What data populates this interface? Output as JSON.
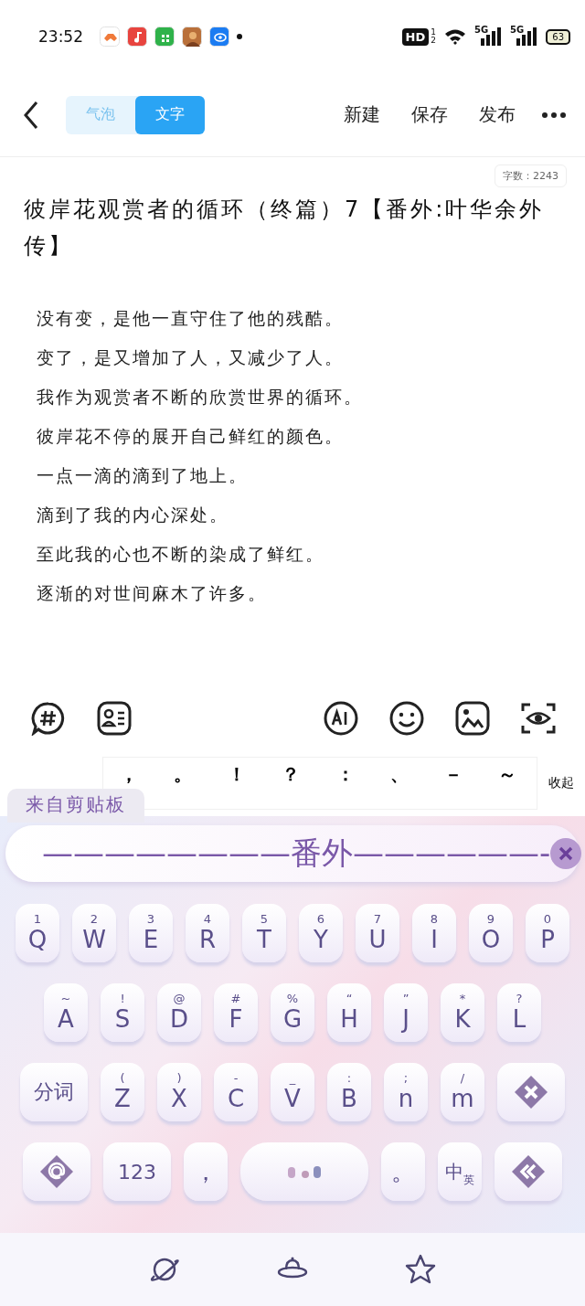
{
  "status_bar": {
    "time": "23:52",
    "hd": "HD",
    "sims": [
      "1",
      "2"
    ],
    "signals": [
      "5G",
      "5G"
    ],
    "battery": "63"
  },
  "header": {
    "tabs": [
      {
        "label": "气泡",
        "selected": false
      },
      {
        "label": "文字",
        "selected": true
      }
    ],
    "actions": [
      "新建",
      "保存",
      "发布"
    ]
  },
  "editor": {
    "word_count": "字数：2243",
    "title": "彼岸花观赏者的循环（终篇）7【番外:叶华余外传】",
    "lines": [
      "没有变，是他一直守住了他的残酷。",
      "变了，是又增加了人，又减少了人。",
      "我作为观赏者不断的欣赏世界的循环。",
      "彼岸花不停的展开自己鲜红的颜色。",
      "一点一滴的滴到了地上。",
      "滴到了我的内心深处。",
      "至此我的心也不断的染成了鲜红。",
      "逐渐的对世间麻木了许多。"
    ]
  },
  "punctuation": {
    "marks": [
      "，",
      "。",
      "！",
      "？",
      "：",
      "、",
      "－",
      "～"
    ],
    "collapse": "收起"
  },
  "clipboard": {
    "tab": "来自剪贴板",
    "text": "————————番外——————-"
  },
  "keyboard": {
    "rows": [
      {
        "keys": [
          {
            "kind": "letter",
            "main": "Q",
            "sub": "1"
          },
          {
            "kind": "letter",
            "main": "W",
            "sub": "2"
          },
          {
            "kind": "letter",
            "main": "E",
            "sub": "3"
          },
          {
            "kind": "letter",
            "main": "R",
            "sub": "4"
          },
          {
            "kind": "letter",
            "main": "T",
            "sub": "5"
          },
          {
            "kind": "letter",
            "main": "Y",
            "sub": "6"
          },
          {
            "kind": "letter",
            "main": "U",
            "sub": "7"
          },
          {
            "kind": "letter",
            "main": "I",
            "sub": "8"
          },
          {
            "kind": "letter",
            "main": "O",
            "sub": "9"
          },
          {
            "kind": "letter",
            "main": "P",
            "sub": "0"
          }
        ]
      },
      {
        "keys": [
          {
            "kind": "letter",
            "main": "A",
            "sub": "~"
          },
          {
            "kind": "letter",
            "main": "S",
            "sub": "!"
          },
          {
            "kind": "letter",
            "main": "D",
            "sub": "@"
          },
          {
            "kind": "letter",
            "main": "F",
            "sub": "#"
          },
          {
            "kind": "letter",
            "main": "G",
            "sub": "%"
          },
          {
            "kind": "letter",
            "main": "H",
            "sub": "“"
          },
          {
            "kind": "letter",
            "main": "J",
            "sub": "”"
          },
          {
            "kind": "letter",
            "main": "K",
            "sub": "*"
          },
          {
            "kind": "letter",
            "main": "L",
            "sub": "?"
          }
        ]
      },
      {
        "keys": [
          {
            "kind": "wide",
            "main": "分词"
          },
          {
            "kind": "letter",
            "main": "Z",
            "sub": "("
          },
          {
            "kind": "letter",
            "main": "X",
            "sub": ")"
          },
          {
            "kind": "letter",
            "main": "C",
            "sub": "-"
          },
          {
            "kind": "letter",
            "main": "V",
            "sub": "_"
          },
          {
            "kind": "letter",
            "main": "B",
            "sub": ":"
          },
          {
            "kind": "letter",
            "main": "n",
            "sub": ";"
          },
          {
            "kind": "letter",
            "main": "m",
            "sub": "/"
          },
          {
            "kind": "delete"
          }
        ]
      },
      {
        "keys": [
          {
            "kind": "at"
          },
          {
            "kind": "wide",
            "main": "123"
          },
          {
            "kind": "letter",
            "main": "，"
          },
          {
            "kind": "space"
          },
          {
            "kind": "letter",
            "main": "。"
          },
          {
            "kind": "lang",
            "main": "中",
            "sub": "英"
          },
          {
            "kind": "enter"
          }
        ]
      }
    ]
  }
}
